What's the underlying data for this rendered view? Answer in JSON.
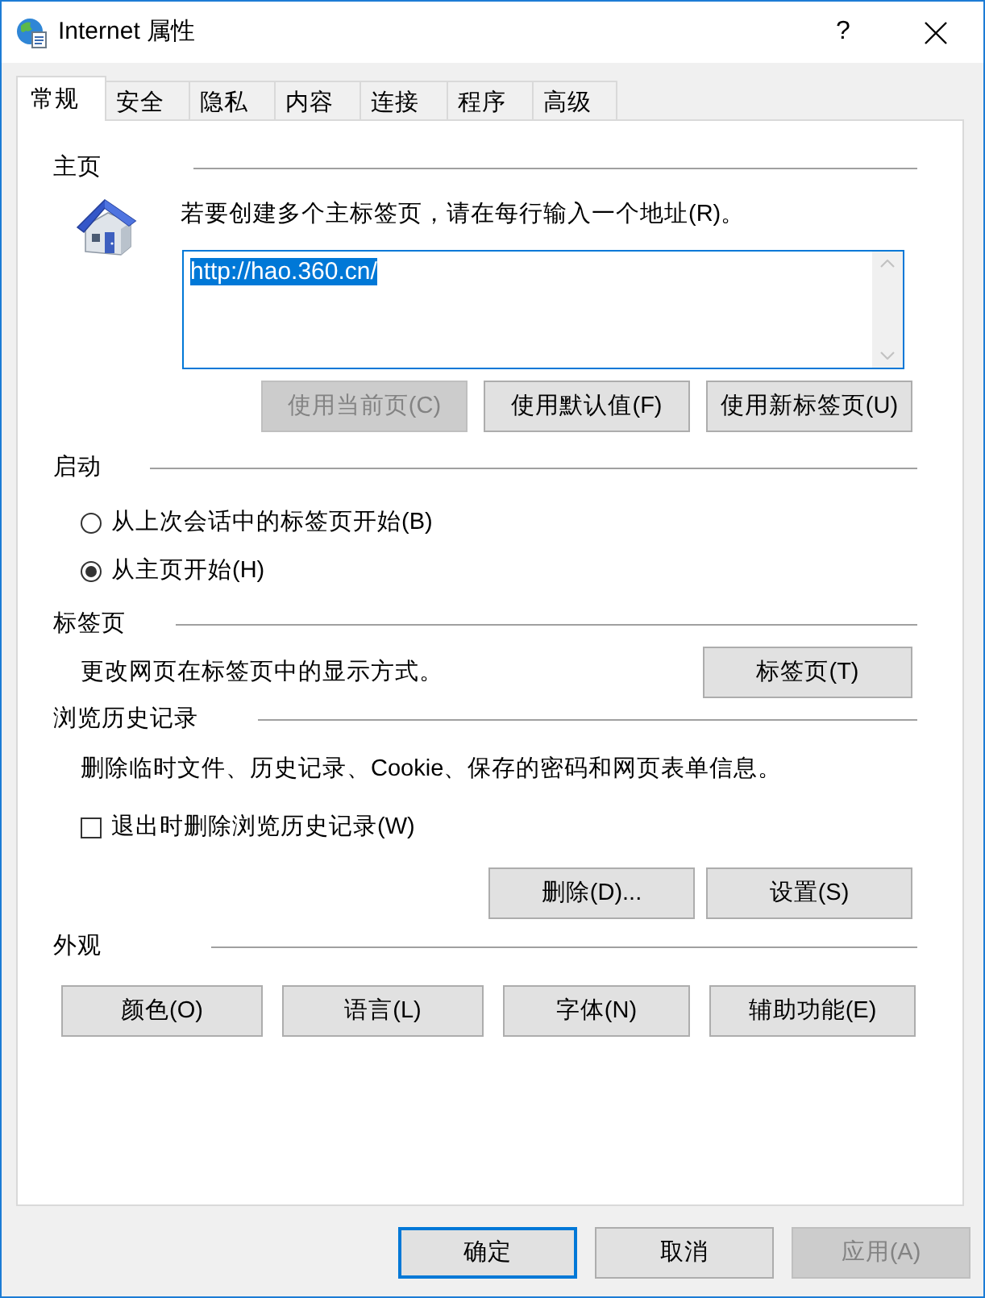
{
  "window": {
    "title": "Internet 属性",
    "help_button": "?"
  },
  "tabs": [
    {
      "label": "常规",
      "selected": true
    },
    {
      "label": "安全",
      "selected": false
    },
    {
      "label": "隐私",
      "selected": false
    },
    {
      "label": "内容",
      "selected": false
    },
    {
      "label": "连接",
      "selected": false
    },
    {
      "label": "程序",
      "selected": false
    },
    {
      "label": "高级",
      "selected": false
    }
  ],
  "home_page": {
    "heading": "主页",
    "hint": "若要创建多个主标签页，请在每行输入一个地址(R)。",
    "address_box": {
      "value": "http://hao.360.cn/",
      "text_selected": true
    },
    "buttons": [
      {
        "label": "使用当前页(C)",
        "disabled": true
      },
      {
        "label": "使用默认值(F)",
        "disabled": false
      },
      {
        "label": "使用新标签页(U)",
        "disabled": false
      }
    ]
  },
  "startup": {
    "heading": "启动",
    "options": [
      {
        "label": "从上次会话中的标签页开始(B)",
        "selected": false
      },
      {
        "label": "从主页开始(H)",
        "selected": true
      }
    ]
  },
  "tab_settings": {
    "heading": "标签页",
    "description": "更改网页在标签页中的显示方式。",
    "button": {
      "label": "标签页(T)",
      "disabled": false
    }
  },
  "browsing_history": {
    "heading": "浏览历史记录",
    "description": "删除临时文件、历史记录、Cookie、保存的密码和网页表单信息。",
    "delete_on_exit": {
      "label": "退出时删除浏览历史记录(W)",
      "checked": false
    },
    "buttons": [
      {
        "label": "删除(D)...",
        "disabled": false
      },
      {
        "label": "设置(S)",
        "disabled": false
      }
    ]
  },
  "appearance": {
    "heading": "外观",
    "buttons": [
      {
        "label": "颜色(O)",
        "disabled": false
      },
      {
        "label": "语言(L)",
        "disabled": false
      },
      {
        "label": "字体(N)",
        "disabled": false
      },
      {
        "label": "辅助功能(E)",
        "disabled": false
      }
    ]
  },
  "dialog_buttons": [
    {
      "label": "确定",
      "default": true,
      "disabled": false
    },
    {
      "label": "取消",
      "default": false,
      "disabled": false
    },
    {
      "label": "应用(A)",
      "default": false,
      "disabled": true
    }
  ]
}
